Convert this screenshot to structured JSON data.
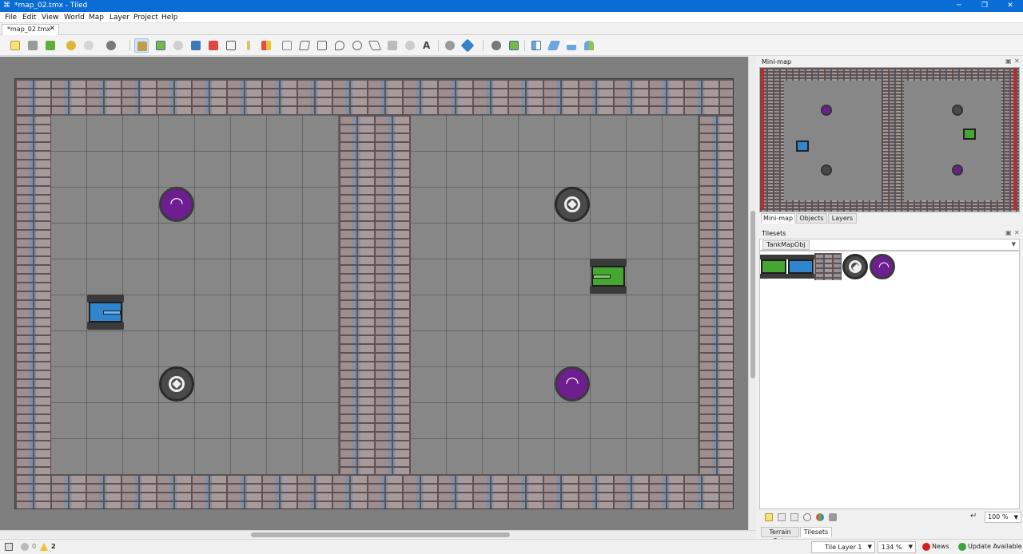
{
  "window": {
    "title": "*map_02.tmx - Tiled",
    "app_icon": "tiled-icon",
    "minimize": "─",
    "maximize": "❐",
    "close": "✕"
  },
  "menu": [
    "File",
    "Edit",
    "View",
    "World",
    "Map",
    "Layer",
    "Project",
    "Help"
  ],
  "document_tab": {
    "label": "*map_02.tmx",
    "close": "✕"
  },
  "toolbar": {
    "icons": [
      "new-map-icon",
      "open-icon",
      "save-icon",
      "undo-icon",
      "redo-icon",
      "commands-icon",
      "stamp-brush-icon",
      "terrain-brush-icon",
      "bucket-fill-icon",
      "shape-fill-icon",
      "eraser-icon",
      "rect-select-icon",
      "magic-wand-icon",
      "select-same-tile-icon",
      "select-objects-icon",
      "edit-polygons-icon",
      "insert-rectangle-icon",
      "insert-point-icon",
      "insert-ellipse-icon",
      "insert-polygon-icon",
      "insert-tile-icon",
      "insert-template-icon",
      "insert-text-icon",
      "random-mode-icon",
      "wang-fill-icon",
      "rotate-left-icon",
      "flip-horizontal-icon",
      "flip-vertical-icon",
      "rotate-right-icon",
      "rotate-icon"
    ]
  },
  "map": {
    "objects": [
      {
        "kind": "signal",
        "name": "signal-token"
      },
      {
        "kind": "gear",
        "name": "gear-token"
      },
      {
        "kind": "tank-blue",
        "name": "blue-tank"
      },
      {
        "kind": "tank-green",
        "name": "green-tank"
      }
    ],
    "colors": {
      "floor": "#878787",
      "brick": "#8a7f80",
      "signal": "#6d1e8f",
      "gear": "#4a4a4a",
      "tank_blue": "#2f86cf",
      "tank_green": "#45a634"
    }
  },
  "minimap_panel": {
    "title": "Mini-map",
    "tabs": [
      "Mini-map",
      "Objects",
      "Layers"
    ],
    "active_tab": "Mini-map"
  },
  "tilesets_panel": {
    "title": "Tilesets",
    "tileset_name": "TankMapObj",
    "tiles": [
      "green-tank-tile",
      "blue-tank-tile",
      "brick-tile",
      "gear-tile",
      "signal-tile"
    ],
    "zoom": "100 %",
    "bottom_tabs": [
      "Terrain Sets",
      "Tilesets"
    ],
    "active_tab": "Tilesets"
  },
  "status": {
    "errors": "0",
    "warnings": "2",
    "layer": "Tile Layer 1",
    "zoom": "134 %",
    "news": "News",
    "update": "Update Available"
  }
}
